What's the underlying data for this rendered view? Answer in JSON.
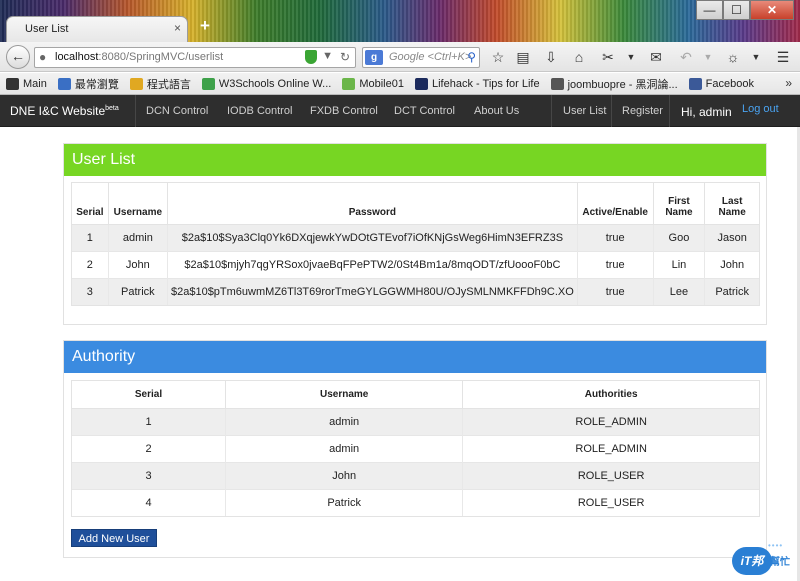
{
  "browser": {
    "tab_title": "User List",
    "tab_close": "×",
    "new_tab": "+",
    "window_controls": {
      "minimize": "—",
      "maximize": "☐",
      "close": "✕"
    },
    "url_host": "localhost",
    "url_rest": ":8080/SpringMVC/userlist",
    "search_engine": "g",
    "search_placeholder": "Google <Ctrl+K>",
    "bookmarks": [
      {
        "label": "Main",
        "icon": "page-icon",
        "color": "#333333"
      },
      {
        "label": "最常瀏覽",
        "icon": "star-icon",
        "color": "#3a6fc4"
      },
      {
        "label": "程式語言",
        "icon": "folder-icon",
        "color": "#e0a821"
      },
      {
        "label": "W3Schools Online W...",
        "icon": "w3-icon",
        "color": "#3ea14a"
      },
      {
        "label": "Mobile01",
        "icon": "mobile01-icon",
        "color": "#6bb64a"
      },
      {
        "label": "Lifehack - Tips for Life",
        "icon": "lifehack-icon",
        "color": "#1b2a5c"
      },
      {
        "label": "joombuopre - 黑洞論...",
        "icon": "joombuopre-icon",
        "color": "#555555"
      },
      {
        "label": "Facebook",
        "icon": "facebook-icon",
        "color": "#3b5998"
      }
    ],
    "bookmarks_more": "»"
  },
  "site": {
    "brand": "DNE I&C Website",
    "brand_sup": "beta",
    "nav": [
      "DCN Control",
      "IODB Control",
      "FXDB Control",
      "DCT Control",
      "About Us"
    ],
    "user_list_link": "User List",
    "register_link": "Register",
    "greeting": "Hi, admin",
    "logout": "Log out"
  },
  "user_panel": {
    "title": "User List",
    "columns": [
      "Serial",
      "Username",
      "Password",
      "Active/Enable",
      "First Name",
      "Last Name"
    ],
    "rows": [
      [
        "1",
        "admin",
        "$2a$10$Sya3Clq0Yk6DXqjewkYwDOtGTEvof7iOfKNjGsWeg6HimN3EFRZ3S",
        "true",
        "Goo",
        "Jason"
      ],
      [
        "2",
        "John",
        "$2a$10$mjyh7qgYRSox0jvaeBqFPePTW2/0St4Bm1a/8mqODT/zfUoooF0bC",
        "true",
        "Lin",
        "John"
      ],
      [
        "3",
        "Patrick",
        "$2a$10$pTm6uwmMZ6Tl3T69rorTmeGYLGGWMH80U/OJySMLNMKFFDh9C.XO",
        "true",
        "Lee",
        "Patrick"
      ]
    ]
  },
  "authority_panel": {
    "title": "Authority",
    "columns": [
      "Serial",
      "Username",
      "Authorities"
    ],
    "rows": [
      [
        "1",
        "admin",
        "ROLE_ADMIN"
      ],
      [
        "2",
        "admin",
        "ROLE_ADMIN"
      ],
      [
        "3",
        "John",
        "ROLE_USER"
      ],
      [
        "4",
        "Patrick",
        "ROLE_USER"
      ]
    ]
  },
  "add_user_button": "Add New User",
  "watermark": {
    "logo": "iT邦",
    "text": "幫忙",
    "dots": "••••"
  }
}
